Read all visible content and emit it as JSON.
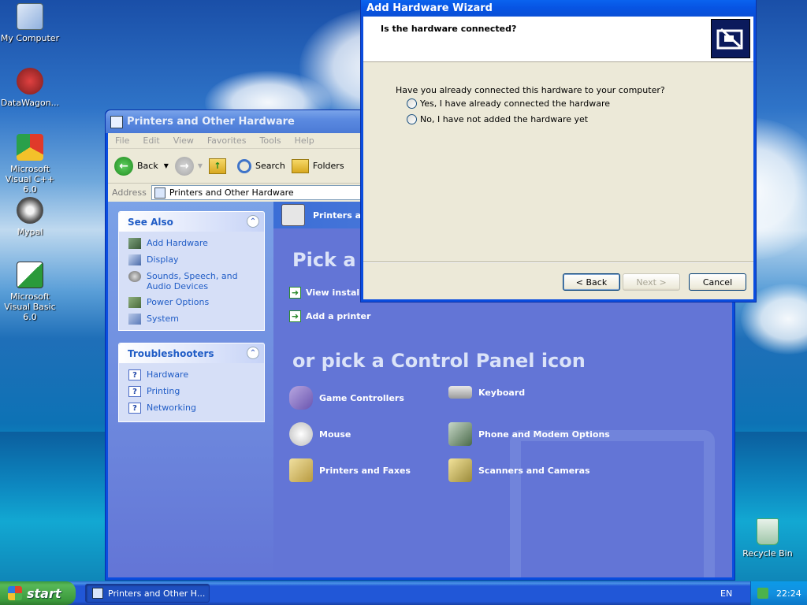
{
  "desktop": {
    "icons": [
      {
        "label": "My Computer"
      },
      {
        "label": "DataWagon..."
      },
      {
        "label": "Microsoft Visual C++ 6.0"
      },
      {
        "label": "Mypal"
      },
      {
        "label": "Microsoft Visual Basic 6.0"
      },
      {
        "label": "Recycle Bin"
      }
    ]
  },
  "explorer": {
    "title": "Printers and Other Hardware",
    "menu": [
      "File",
      "Edit",
      "View",
      "Favorites",
      "Tools",
      "Help"
    ],
    "toolbar": {
      "back": "Back",
      "search": "Search",
      "folders": "Folders"
    },
    "address_label": "Address",
    "address_value": "Printers and Other Hardware",
    "see_also": {
      "title": "See Also",
      "items": [
        "Add Hardware",
        "Display",
        "Sounds, Speech, and Audio Devices",
        "Power Options",
        "System"
      ]
    },
    "troubleshooters": {
      "title": "Troubleshooters",
      "items": [
        "Hardware",
        "Printing",
        "Networking"
      ]
    },
    "main": {
      "header": "Printers ar",
      "pick_task": "Pick a",
      "tasks": [
        "View installe",
        "Add a printer"
      ],
      "pick_icon": "or pick a Control Panel icon",
      "cp_items": [
        "Game Controllers",
        "Keyboard",
        "Mouse",
        "Phone and Modem Options",
        "Printers and Faxes",
        "Scanners and Cameras"
      ]
    }
  },
  "wizard": {
    "title": "Add Hardware Wizard",
    "heading": "Is the hardware connected?",
    "question": "Have you already connected this hardware to your computer?",
    "options": [
      "Yes, I have already connected the hardware",
      "No, I have not added the hardware yet"
    ],
    "selected_option": null,
    "buttons": {
      "back": "< Back",
      "next": "Next >",
      "cancel": "Cancel"
    }
  },
  "taskbar": {
    "start": "start",
    "task": "Printers and Other H...",
    "language": "EN",
    "clock": "22:24"
  }
}
